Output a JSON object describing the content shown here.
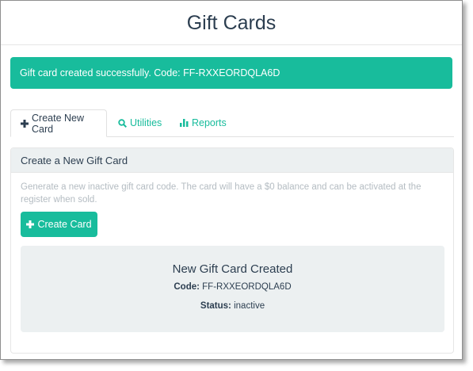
{
  "header": {
    "title": "Gift Cards"
  },
  "alert": {
    "message": "Gift card created successfully. Code: FF-RXXEORDQLA6D"
  },
  "tabs": [
    {
      "label": "Create New Card",
      "icon": "plus-icon",
      "active": true
    },
    {
      "label": "Utilities",
      "icon": "search-icon",
      "active": false
    },
    {
      "label": "Reports",
      "icon": "bar-chart-icon",
      "active": false
    }
  ],
  "panel": {
    "heading": "Create a New Gift Card",
    "description": "Generate a new inactive gift card code. The card will have a $0 balance and can be activated at the register when sold.",
    "button_label": "Create Card"
  },
  "result": {
    "title": "New Gift Card Created",
    "code_label": "Code:",
    "code_value": "FF-RXXEORDQLA6D",
    "status_label": "Status:",
    "status_value": "inactive"
  },
  "colors": {
    "accent": "#18bc9c",
    "text": "#2c3e50",
    "muted": "#b4bcc2",
    "panel_bg": "#ecf0f1"
  }
}
